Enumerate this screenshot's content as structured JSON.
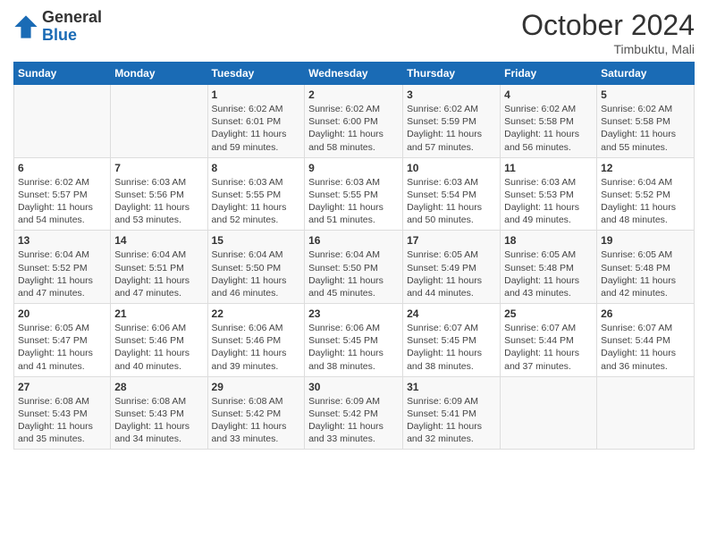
{
  "logo": {
    "general": "General",
    "blue": "Blue"
  },
  "header": {
    "month": "October 2024",
    "location": "Timbuktu, Mali"
  },
  "weekdays": [
    "Sunday",
    "Monday",
    "Tuesday",
    "Wednesday",
    "Thursday",
    "Friday",
    "Saturday"
  ],
  "weeks": [
    [
      null,
      null,
      {
        "day": 1,
        "sunrise": "6:02 AM",
        "sunset": "6:01 PM",
        "daylight": "11 hours and 59 minutes."
      },
      {
        "day": 2,
        "sunrise": "6:02 AM",
        "sunset": "6:00 PM",
        "daylight": "11 hours and 58 minutes."
      },
      {
        "day": 3,
        "sunrise": "6:02 AM",
        "sunset": "5:59 PM",
        "daylight": "11 hours and 57 minutes."
      },
      {
        "day": 4,
        "sunrise": "6:02 AM",
        "sunset": "5:58 PM",
        "daylight": "11 hours and 56 minutes."
      },
      {
        "day": 5,
        "sunrise": "6:02 AM",
        "sunset": "5:58 PM",
        "daylight": "11 hours and 55 minutes."
      }
    ],
    [
      {
        "day": 6,
        "sunrise": "6:02 AM",
        "sunset": "5:57 PM",
        "daylight": "11 hours and 54 minutes."
      },
      {
        "day": 7,
        "sunrise": "6:03 AM",
        "sunset": "5:56 PM",
        "daylight": "11 hours and 53 minutes."
      },
      {
        "day": 8,
        "sunrise": "6:03 AM",
        "sunset": "5:55 PM",
        "daylight": "11 hours and 52 minutes."
      },
      {
        "day": 9,
        "sunrise": "6:03 AM",
        "sunset": "5:55 PM",
        "daylight": "11 hours and 51 minutes."
      },
      {
        "day": 10,
        "sunrise": "6:03 AM",
        "sunset": "5:54 PM",
        "daylight": "11 hours and 50 minutes."
      },
      {
        "day": 11,
        "sunrise": "6:03 AM",
        "sunset": "5:53 PM",
        "daylight": "11 hours and 49 minutes."
      },
      {
        "day": 12,
        "sunrise": "6:04 AM",
        "sunset": "5:52 PM",
        "daylight": "11 hours and 48 minutes."
      }
    ],
    [
      {
        "day": 13,
        "sunrise": "6:04 AM",
        "sunset": "5:52 PM",
        "daylight": "11 hours and 47 minutes."
      },
      {
        "day": 14,
        "sunrise": "6:04 AM",
        "sunset": "5:51 PM",
        "daylight": "11 hours and 47 minutes."
      },
      {
        "day": 15,
        "sunrise": "6:04 AM",
        "sunset": "5:50 PM",
        "daylight": "11 hours and 46 minutes."
      },
      {
        "day": 16,
        "sunrise": "6:04 AM",
        "sunset": "5:50 PM",
        "daylight": "11 hours and 45 minutes."
      },
      {
        "day": 17,
        "sunrise": "6:05 AM",
        "sunset": "5:49 PM",
        "daylight": "11 hours and 44 minutes."
      },
      {
        "day": 18,
        "sunrise": "6:05 AM",
        "sunset": "5:48 PM",
        "daylight": "11 hours and 43 minutes."
      },
      {
        "day": 19,
        "sunrise": "6:05 AM",
        "sunset": "5:48 PM",
        "daylight": "11 hours and 42 minutes."
      }
    ],
    [
      {
        "day": 20,
        "sunrise": "6:05 AM",
        "sunset": "5:47 PM",
        "daylight": "11 hours and 41 minutes."
      },
      {
        "day": 21,
        "sunrise": "6:06 AM",
        "sunset": "5:46 PM",
        "daylight": "11 hours and 40 minutes."
      },
      {
        "day": 22,
        "sunrise": "6:06 AM",
        "sunset": "5:46 PM",
        "daylight": "11 hours and 39 minutes."
      },
      {
        "day": 23,
        "sunrise": "6:06 AM",
        "sunset": "5:45 PM",
        "daylight": "11 hours and 38 minutes."
      },
      {
        "day": 24,
        "sunrise": "6:07 AM",
        "sunset": "5:45 PM",
        "daylight": "11 hours and 38 minutes."
      },
      {
        "day": 25,
        "sunrise": "6:07 AM",
        "sunset": "5:44 PM",
        "daylight": "11 hours and 37 minutes."
      },
      {
        "day": 26,
        "sunrise": "6:07 AM",
        "sunset": "5:44 PM",
        "daylight": "11 hours and 36 minutes."
      }
    ],
    [
      {
        "day": 27,
        "sunrise": "6:08 AM",
        "sunset": "5:43 PM",
        "daylight": "11 hours and 35 minutes."
      },
      {
        "day": 28,
        "sunrise": "6:08 AM",
        "sunset": "5:43 PM",
        "daylight": "11 hours and 34 minutes."
      },
      {
        "day": 29,
        "sunrise": "6:08 AM",
        "sunset": "5:42 PM",
        "daylight": "11 hours and 33 minutes."
      },
      {
        "day": 30,
        "sunrise": "6:09 AM",
        "sunset": "5:42 PM",
        "daylight": "11 hours and 33 minutes."
      },
      {
        "day": 31,
        "sunrise": "6:09 AM",
        "sunset": "5:41 PM",
        "daylight": "11 hours and 32 minutes."
      },
      null,
      null
    ]
  ]
}
